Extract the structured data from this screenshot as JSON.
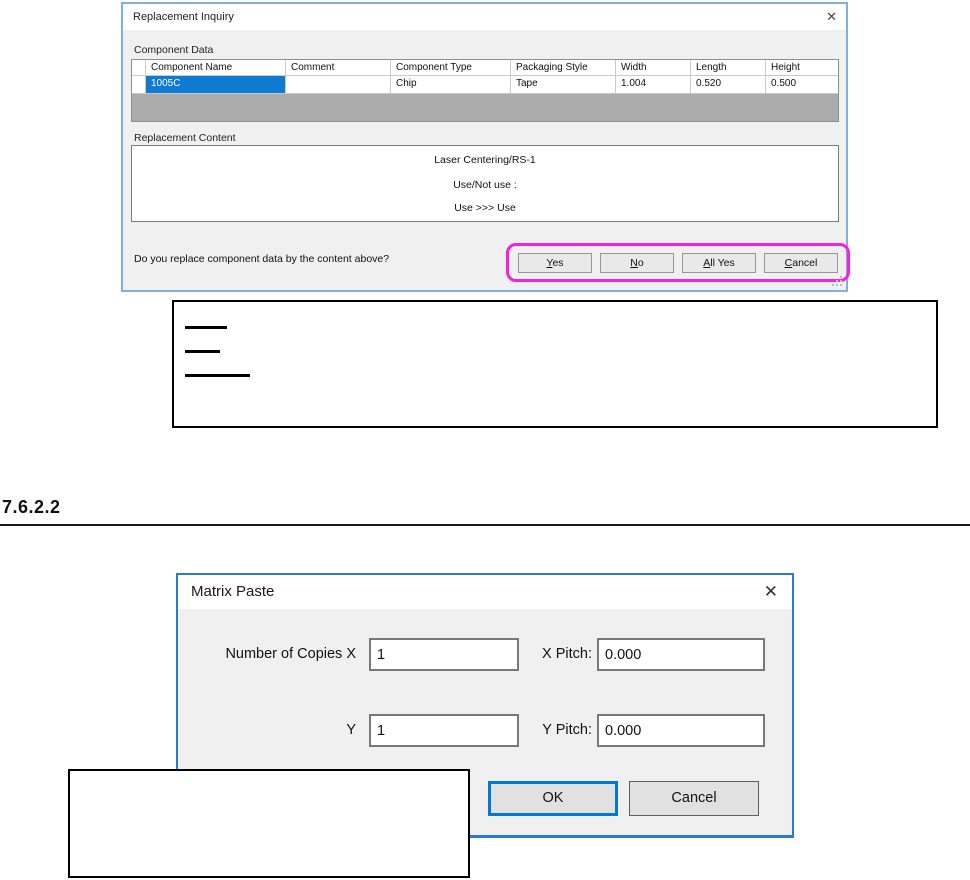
{
  "colors": {
    "highlight": "#f322de",
    "selection": "#0f7ad1",
    "focus": "#0078d7"
  },
  "section": {
    "heading": "7.6.2.2"
  },
  "replacement_inquiry": {
    "title": "Replacement Inquiry",
    "close_icon": "✕",
    "component_data_label": "Component Data",
    "table": {
      "columns": [
        "",
        "Component Name",
        "Comment",
        "Component Type",
        "Packaging Style",
        "Width",
        "Length",
        "Height"
      ],
      "row": [
        "",
        "1005C",
        "",
        "Chip",
        "Tape",
        "1.004",
        "0.520",
        "0.500"
      ]
    },
    "replacement_content_label": "Replacement Content",
    "content_lines": [
      "Laser Centering/RS-1",
      "Use/Not use :",
      "Use >>> Use"
    ],
    "question": "Do you replace component data by the content above?",
    "buttons": {
      "yes": "Yes",
      "no": "No",
      "all_yes": "All Yes",
      "cancel": "Cancel"
    }
  },
  "matrix_paste": {
    "title": "Matrix Paste",
    "close_icon": "✕",
    "fields": {
      "copies_x_label": "Number of Copies X",
      "copies_x_value": "1",
      "x_pitch_label": "X Pitch:",
      "x_pitch_value": "0.000",
      "copies_y_label": "Y",
      "copies_y_value": "1",
      "y_pitch_label": "Y Pitch:",
      "y_pitch_value": "0.000"
    },
    "buttons": {
      "ok": "OK",
      "cancel": "Cancel"
    }
  }
}
